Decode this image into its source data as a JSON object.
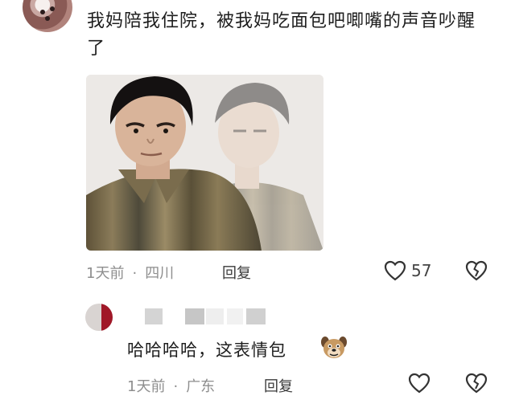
{
  "comment": {
    "text": "我妈陪我住院，被我妈吃面包吧唧嘴的声音吵醒了",
    "time": "1天前",
    "location": "四川",
    "reply_label": "回复",
    "like_count": "57"
  },
  "reply": {
    "text": "哈哈哈哈，这表情包",
    "time": "1天前",
    "location": "广东",
    "reply_label": "回复"
  },
  "icons": {
    "like": "heart-outline-icon",
    "dislike": "broken-heart-icon",
    "emoji": "dog-face-emoji"
  }
}
